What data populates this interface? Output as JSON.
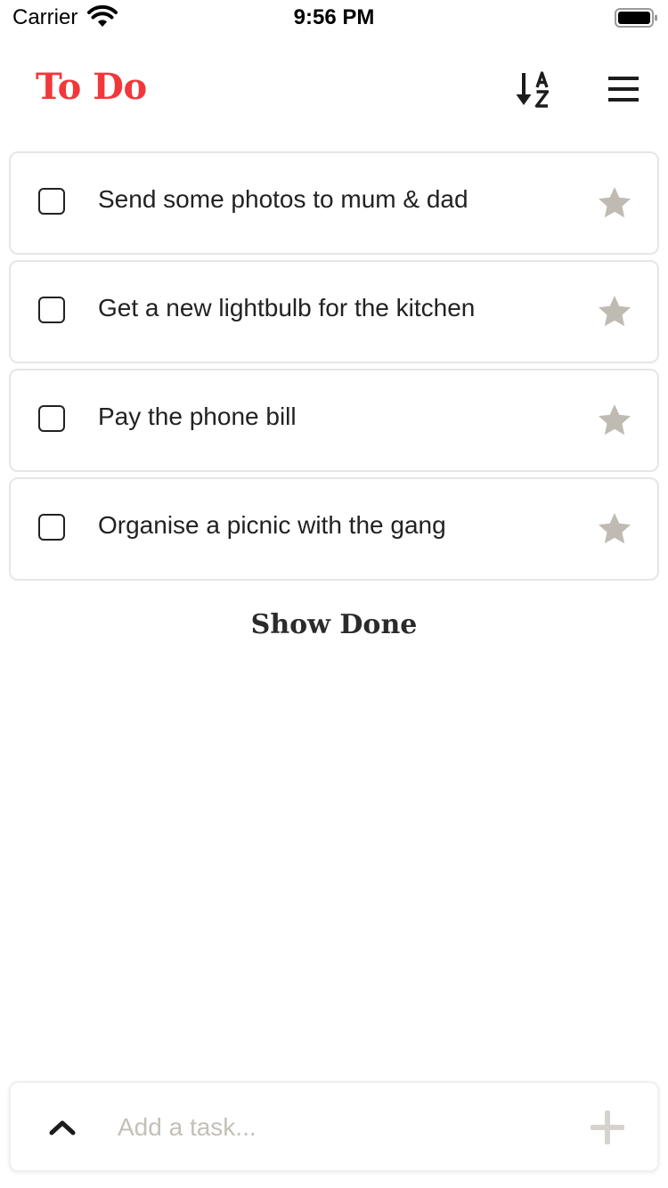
{
  "status_bar": {
    "carrier": "Carrier",
    "time": "9:56 PM",
    "icons": [
      "wifi-icon",
      "battery-icon"
    ]
  },
  "header": {
    "title": "To Do",
    "title_color": "#f2373b",
    "sort_icon": "sort-alpha-down-icon",
    "menu_icon": "hamburger-menu-icon"
  },
  "tasks": [
    {
      "label": "Send some photos to mum & dad",
      "done": false,
      "starred": false
    },
    {
      "label": "Get a new lightbulb for the kitchen",
      "done": false,
      "starred": false
    },
    {
      "label": "Pay the phone bill",
      "done": false,
      "starred": false
    },
    {
      "label": "Organise a picnic with the gang",
      "done": false,
      "starred": false
    }
  ],
  "show_done_label": "Show Done",
  "add_bar": {
    "placeholder": "Add a task...",
    "value": "",
    "expand_icon": "chevron-up-icon",
    "add_icon": "plus-icon"
  },
  "colors": {
    "accent": "#f2373b",
    "star": "#bfbbb3",
    "placeholder": "#c4c0b8"
  }
}
